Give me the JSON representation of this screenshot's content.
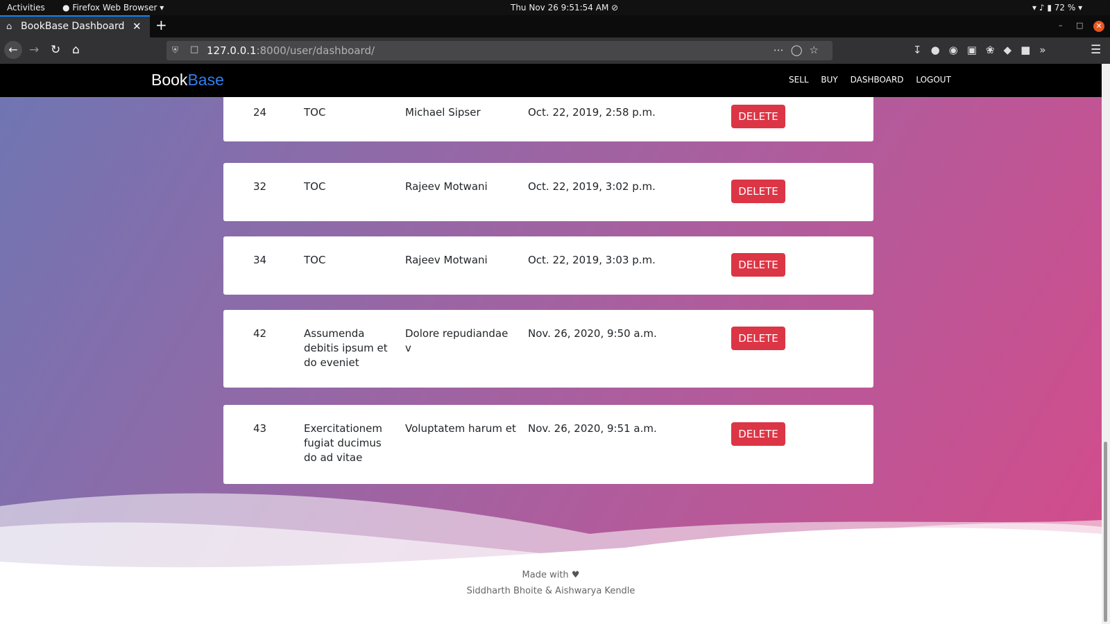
{
  "system_bar": {
    "activities": "Activities",
    "app_name": "Firefox Web Browser",
    "clock": "Thu Nov 26  9:51:54 AM",
    "battery": "72 %"
  },
  "browser": {
    "tab_title": "BookBase Dashboard",
    "url_host": "127.0.0.1",
    "url_rest": ":8000/user/dashboard/"
  },
  "site": {
    "brand_part1": "Book",
    "brand_part2": "Base",
    "brand_accent_color": "#2f7ff0",
    "nav": [
      "SELL",
      "BUY",
      "DASHBOARD",
      "LOGOUT"
    ]
  },
  "rows": [
    {
      "id": "24",
      "title": "TOC",
      "author": "Michael Sipser",
      "date": "Oct. 22, 2019, 2:58 p.m.",
      "action": "DELETE"
    },
    {
      "id": "32",
      "title": "TOC",
      "author": "Rajeev Motwani",
      "date": "Oct. 22, 2019, 3:02 p.m.",
      "action": "DELETE"
    },
    {
      "id": "34",
      "title": "TOC",
      "author": "Rajeev Motwani",
      "date": "Oct. 22, 2019, 3:03 p.m.",
      "action": "DELETE"
    },
    {
      "id": "42",
      "title": "Assumenda debitis ipsum et do eveniet",
      "author": "Dolore repudiandae v",
      "date": "Nov. 26, 2020, 9:50 a.m.",
      "action": "DELETE"
    },
    {
      "id": "43",
      "title": "Exercitationem fugiat ducimus do ad vitae",
      "author": "Voluptatem harum et",
      "date": "Nov. 26, 2020, 9:51 a.m.",
      "action": "DELETE"
    }
  ],
  "footer": {
    "made_with": "Made with",
    "authors": "Siddharth Bhoite & Aishwarya Kendle"
  },
  "colors": {
    "delete_button": "#dc3545",
    "gradient_start": "#6e76b3",
    "gradient_end": "#d54b8a"
  }
}
